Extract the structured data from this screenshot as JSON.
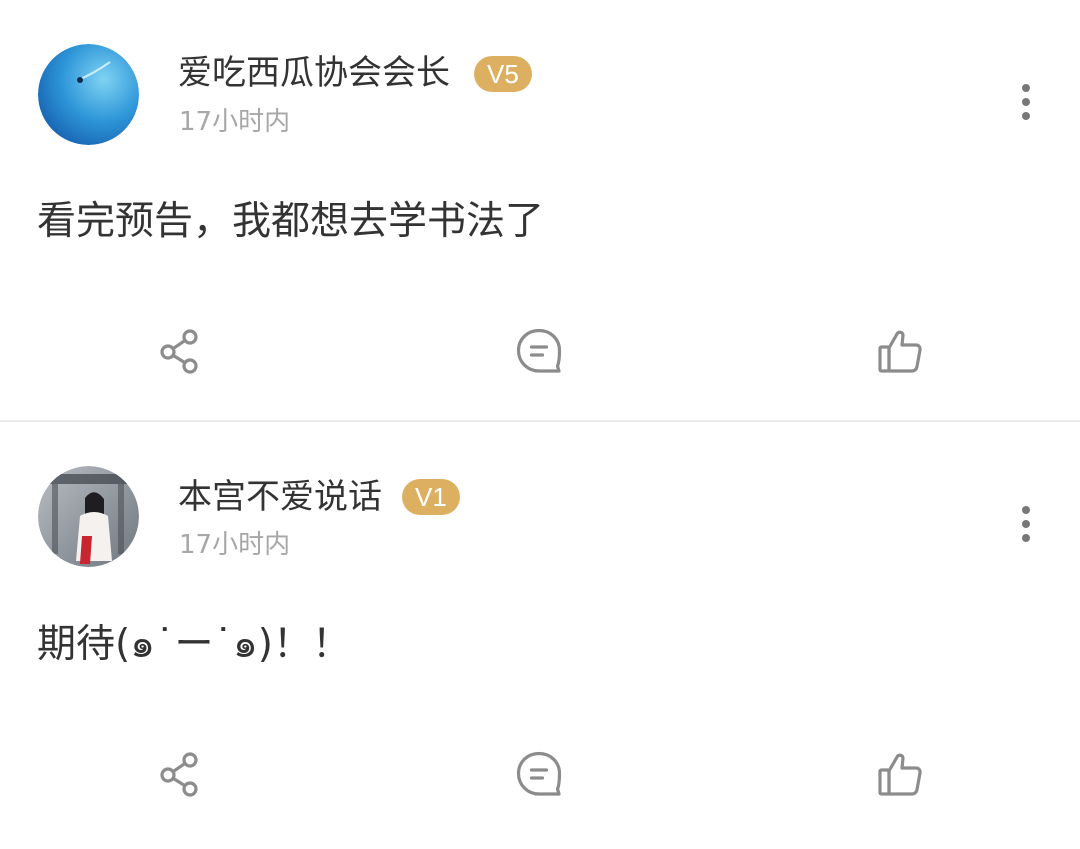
{
  "posts": [
    {
      "username": "爱吃西瓜协会会长",
      "level": "V5",
      "time": "17小时内",
      "text": "看完预告，我都想去学书法了"
    },
    {
      "username": "本宫不爱说话",
      "level": "V1",
      "time": "17小时内",
      "text": "期待(๑˙ー˙๑)！！"
    }
  ],
  "colors": {
    "level_badge": "#dcb060",
    "timestamp": "#a7a7a7",
    "icon": "#8c8c8c",
    "divider": "#ececec"
  },
  "icons": {
    "more": "more-vertical-icon",
    "share": "share-icon",
    "comment": "comment-icon",
    "like": "thumbs-up-icon"
  }
}
